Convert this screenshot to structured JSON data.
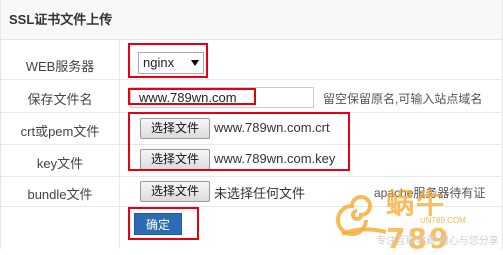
{
  "panel": {
    "title": "SSL证书文件上传"
  },
  "rows": [
    {
      "label": "WEB服务器"
    },
    {
      "label": "保存文件名"
    },
    {
      "label": "crt或pem文件"
    },
    {
      "label": "key文件"
    },
    {
      "label": "bundle文件"
    }
  ],
  "web_server": {
    "selected": "nginx"
  },
  "save_name": {
    "value": "www.789wn.com",
    "hint": "留空保留原名,可输入站点域名"
  },
  "crt": {
    "button": "选择文件",
    "filename": "www.789wn.com.crt"
  },
  "key": {
    "button": "选择文件",
    "filename": "www.789wn.com.key"
  },
  "bundle": {
    "button": "选择文件",
    "filename": "未选择任何文件",
    "note": "apache服务器待有证"
  },
  "submit": {
    "label": "确定"
  },
  "watermark": {
    "text_main": "蜗牛789",
    "text_sub": "UN789.COM",
    "slogan": "专注互联收藏 用心与您分享"
  },
  "colors": {
    "highlight": "#e60012",
    "primary": "#2d6cb5",
    "watermark": "#f5a623"
  }
}
